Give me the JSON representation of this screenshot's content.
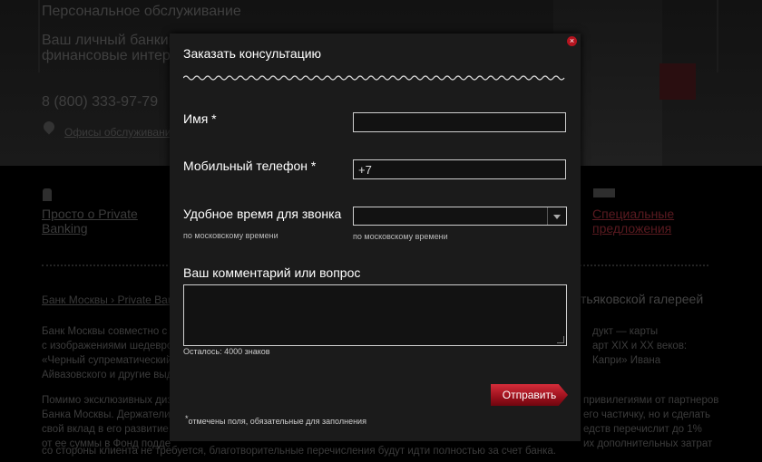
{
  "background": {
    "title": "Персональное обслуживание",
    "subtitle": "Ваш личный банкир финансовые интер",
    "phone": "8 (800) 333-97-79",
    "offices_link": "Офисы обслуживания",
    "nav_link_1": "Просто о Private Banking",
    "nav_link_2": "Специальные предложения",
    "breadcrumb": "Банк Москвы › Private Bank",
    "heading_right": "тьяковской галереей",
    "text_left": [
      "Банк Москвы совместно с",
      "с изображениями шедевро",
      "«Черный супрематический",
      "Айвазовского и другие выд"
    ],
    "text_right": [
      "дукт — карты",
      "арт XIX и XX веков:",
      "Капри» Ивана"
    ],
    "para2_left": [
      "Помимо эксклюзивных диз",
      "Банка Москвы. Держатели",
      "свой вклад в его развитие.",
      "от ее суммы в Фонд подде"
    ],
    "para2_right": [
      "привилегиями от партнеров",
      "его частичку, но и сделать",
      "едств перечислит до 1%",
      "их дополнительных затрат"
    ],
    "para2_last": "со стороны клиента не требуется, благотворительные перечисления будут идти полностью за счет банка."
  },
  "modal": {
    "title": "Заказать консультацию",
    "close_symbol": "×",
    "name_label": "Имя",
    "phone_label": "Мобильный телефон",
    "phone_value": "+7",
    "time_label": "Удобное время для звонка",
    "time_hint": "по московскому времени",
    "time_select_hint": "по московскому времени",
    "time_selected": "",
    "comment_label": "Ваш комментарий или вопрос",
    "comment_value": "",
    "counter": "Осталось: 4000 знаков",
    "submit_label": "Отправить",
    "required_star": "*",
    "required_note": "отмечены поля, обязательные для заполнения"
  },
  "colors": {
    "accent": "#b5141f",
    "modal_bg": "#1b1b1b",
    "page_bg": "#000000"
  }
}
